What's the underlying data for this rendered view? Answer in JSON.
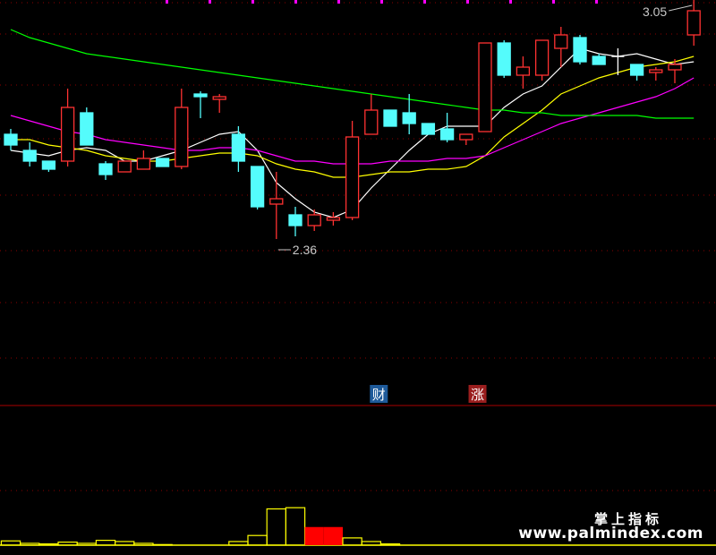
{
  "chart_data": {
    "type": "candlestick",
    "price_scale": {
      "min": 2.0,
      "max": 3.3
    },
    "volume_scale": {
      "min": 0,
      "max": 40
    },
    "candles": [
      {
        "o": 2.9,
        "h": 2.92,
        "l": 2.84,
        "c": 2.86
      },
      {
        "o": 2.84,
        "h": 2.87,
        "l": 2.78,
        "c": 2.8
      },
      {
        "o": 2.8,
        "h": 2.8,
        "l": 2.76,
        "c": 2.77
      },
      {
        "o": 2.8,
        "h": 3.07,
        "l": 2.78,
        "c": 3.0
      },
      {
        "o": 2.98,
        "h": 3.0,
        "l": 2.86,
        "c": 2.86
      },
      {
        "o": 2.79,
        "h": 2.8,
        "l": 2.73,
        "c": 2.75
      },
      {
        "o": 2.76,
        "h": 2.8,
        "l": 2.76,
        "c": 2.8
      },
      {
        "o": 2.77,
        "h": 2.84,
        "l": 2.77,
        "c": 2.81
      },
      {
        "o": 2.81,
        "h": 2.81,
        "l": 2.78,
        "c": 2.78
      },
      {
        "o": 2.78,
        "h": 3.07,
        "l": 2.77,
        "c": 3.0
      },
      {
        "o": 3.05,
        "h": 3.06,
        "l": 2.96,
        "c": 3.04
      },
      {
        "o": 3.03,
        "h": 3.05,
        "l": 2.98,
        "c": 3.04
      },
      {
        "o": 2.9,
        "h": 2.93,
        "l": 2.76,
        "c": 2.8
      },
      {
        "o": 2.78,
        "h": 2.78,
        "l": 2.62,
        "c": 2.63
      },
      {
        "o": 2.64,
        "h": 2.76,
        "l": 2.51,
        "c": 2.66
      },
      {
        "o": 2.6,
        "h": 2.63,
        "l": 2.52,
        "c": 2.56
      },
      {
        "o": 2.56,
        "h": 2.62,
        "l": 2.54,
        "c": 2.6
      },
      {
        "o": 2.58,
        "h": 2.61,
        "l": 2.56,
        "c": 2.59
      },
      {
        "o": 2.59,
        "h": 2.95,
        "l": 2.58,
        "c": 2.89
      },
      {
        "o": 2.9,
        "h": 3.05,
        "l": 2.9,
        "c": 2.99
      },
      {
        "o": 2.99,
        "h": 2.99,
        "l": 2.93,
        "c": 2.93
      },
      {
        "o": 2.98,
        "h": 3.05,
        "l": 2.9,
        "c": 2.94
      },
      {
        "o": 2.94,
        "h": 2.94,
        "l": 2.9,
        "c": 2.9
      },
      {
        "o": 2.92,
        "h": 2.98,
        "l": 2.87,
        "c": 2.88
      },
      {
        "o": 2.88,
        "h": 2.9,
        "l": 2.86,
        "c": 2.9
      },
      {
        "o": 2.91,
        "h": 3.24,
        "l": 2.91,
        "c": 3.24
      },
      {
        "o": 3.24,
        "h": 3.25,
        "l": 3.11,
        "c": 3.12
      },
      {
        "o": 3.12,
        "h": 3.19,
        "l": 3.07,
        "c": 3.15
      },
      {
        "o": 3.12,
        "h": 3.24,
        "l": 3.1,
        "c": 3.25
      },
      {
        "o": 3.22,
        "h": 3.3,
        "l": 3.15,
        "c": 3.27
      },
      {
        "o": 3.26,
        "h": 3.27,
        "l": 3.16,
        "c": 3.17
      },
      {
        "o": 3.19,
        "h": 3.2,
        "l": 3.16,
        "c": 3.16
      },
      {
        "o": 3.19,
        "h": 3.22,
        "l": 3.12,
        "c": 3.19
      },
      {
        "o": 3.16,
        "h": 3.16,
        "l": 3.1,
        "c": 3.12
      },
      {
        "o": 3.13,
        "h": 3.15,
        "l": 3.1,
        "c": 3.14
      },
      {
        "o": 3.14,
        "h": 3.18,
        "l": 3.09,
        "c": 3.16
      },
      {
        "o": 3.27,
        "h": 3.4,
        "l": 3.23,
        "c": 3.36
      }
    ],
    "ma_lines": [
      {
        "color": "#FFFFFF",
        "values": [
          2.84,
          2.83,
          2.82,
          2.84,
          2.85,
          2.84,
          2.8,
          2.8,
          2.82,
          2.84,
          2.87,
          2.9,
          2.91,
          2.84,
          2.72,
          2.66,
          2.61,
          2.59,
          2.62,
          2.7,
          2.77,
          2.84,
          2.9,
          2.93,
          2.93,
          2.93,
          3.0,
          3.05,
          3.08,
          3.15,
          3.22,
          3.2,
          3.19,
          3.2,
          3.18,
          3.16,
          3.17
        ]
      },
      {
        "color": "#FFFF00",
        "values": [
          2.88,
          2.88,
          2.86,
          2.85,
          2.84,
          2.82,
          2.81,
          2.8,
          2.8,
          2.81,
          2.82,
          2.83,
          2.83,
          2.82,
          2.79,
          2.77,
          2.76,
          2.74,
          2.74,
          2.75,
          2.76,
          2.76,
          2.77,
          2.77,
          2.78,
          2.82,
          2.89,
          2.94,
          2.99,
          3.05,
          3.08,
          3.11,
          3.13,
          3.15,
          3.16,
          3.17,
          3.19
        ]
      },
      {
        "color": "#FF00FF",
        "values": [
          2.97,
          2.95,
          2.93,
          2.91,
          2.9,
          2.88,
          2.87,
          2.86,
          2.85,
          2.84,
          2.84,
          2.85,
          2.85,
          2.84,
          2.82,
          2.8,
          2.8,
          2.79,
          2.79,
          2.79,
          2.8,
          2.8,
          2.8,
          2.81,
          2.81,
          2.82,
          2.85,
          2.88,
          2.91,
          2.94,
          2.96,
          2.98,
          3.0,
          3.02,
          3.04,
          3.07,
          3.11
        ]
      },
      {
        "color": "#00FF00",
        "values": [
          3.29,
          3.26,
          3.24,
          3.22,
          3.2,
          3.19,
          3.18,
          3.17,
          3.16,
          3.15,
          3.14,
          3.13,
          3.12,
          3.11,
          3.1,
          3.09,
          3.08,
          3.07,
          3.06,
          3.05,
          3.04,
          3.03,
          3.02,
          3.01,
          3.0,
          2.99,
          2.99,
          2.98,
          2.98,
          2.97,
          2.97,
          2.97,
          2.97,
          2.97,
          2.96,
          2.96,
          2.96
        ]
      }
    ],
    "volume": [
      {
        "x": 0,
        "value": 3.5,
        "up": true
      },
      {
        "x": 1,
        "value": 1.5,
        "up": true
      },
      {
        "x": 2,
        "value": 1.0,
        "up": true
      },
      {
        "x": 3,
        "value": 2.5,
        "up": true
      },
      {
        "x": 4,
        "value": 1.5,
        "up": true
      },
      {
        "x": 5,
        "value": 4.0,
        "up": true
      },
      {
        "x": 6,
        "value": 3.0,
        "up": true
      },
      {
        "x": 7,
        "value": 1.5,
        "up": true
      },
      {
        "x": 8,
        "value": 0.5,
        "up": true
      },
      {
        "x": 12,
        "value": 3.0,
        "up": true
      },
      {
        "x": 13,
        "value": 8.0,
        "up": true
      },
      {
        "x": 14,
        "value": 30.0,
        "up": true
      },
      {
        "x": 15,
        "value": 31.0,
        "up": true
      },
      {
        "x": 16,
        "value": 15.0,
        "up": false
      },
      {
        "x": 17,
        "value": 15.0,
        "up": false
      },
      {
        "x": 18,
        "value": 6.0,
        "up": true
      },
      {
        "x": 19,
        "value": 3.0,
        "up": true
      },
      {
        "x": 20,
        "value": 1.0,
        "up": true
      }
    ],
    "annotations": {
      "high_label": "3.05",
      "low_label": "2.36",
      "badge_fall": "财",
      "badge_rise": "涨"
    },
    "colors": {
      "background": "#000000",
      "up": "#FF3232",
      "down": "#54FCFC",
      "grid": "#8B0000",
      "volume_line": "#FFFF00",
      "volume_fill": "#FF0000",
      "badge_fall_bg": "#1E5A9A",
      "badge_rise_bg": "#9A1E1E"
    }
  },
  "branding": {
    "title": "掌上指标",
    "url": "www.palmindex.com"
  }
}
